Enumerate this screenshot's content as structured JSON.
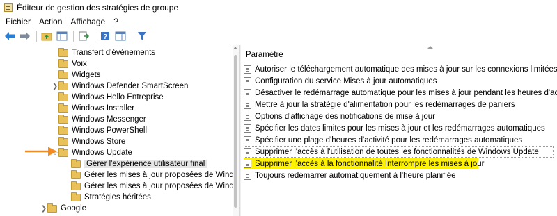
{
  "window": {
    "title": "Éditeur de gestion des stratégies de groupe",
    "icon": "gpedit-app-icon"
  },
  "menu": [
    "Fichier",
    "Action",
    "Affichage",
    "?"
  ],
  "toolbar": {
    "buttons": [
      "back-arrow-icon",
      "forward-arrow-icon",
      "up-folder-icon",
      "show-hide-tree-icon",
      "export-list-icon",
      "help-icon",
      "show-hide-action-icon",
      "filter-icon"
    ],
    "accent_back": "#2b7cd3",
    "filter_color": "#3a73c4"
  },
  "tree": {
    "items": [
      {
        "label": "Transfert d'événements",
        "expander": ""
      },
      {
        "label": "Voix",
        "expander": ""
      },
      {
        "label": "Widgets",
        "expander": ""
      },
      {
        "label": "Windows Defender SmartScreen",
        "expander": "collapsed"
      },
      {
        "label": "Windows Hello Entreprise",
        "expander": ""
      },
      {
        "label": "Windows Installer",
        "expander": ""
      },
      {
        "label": "Windows Messenger",
        "expander": ""
      },
      {
        "label": "Windows PowerShell",
        "expander": ""
      },
      {
        "label": "Windows Store",
        "expander": ""
      },
      {
        "label": "Windows Update",
        "expander": "expanded"
      },
      {
        "label": "Gérer l'expérience utilisateur final",
        "expander": ""
      },
      {
        "label": "Gérer les mises à jour proposées de Windov",
        "expander": ""
      },
      {
        "label": "Gérer les mises à jour proposées de Windov",
        "expander": ""
      },
      {
        "label": "Stratégies héritées",
        "expander": ""
      },
      {
        "label": "Google",
        "expander": "collapsed"
      }
    ],
    "selected_index": 10,
    "annotation_color": "#f08a24"
  },
  "list": {
    "header": "Paramètre",
    "items": [
      "Autoriser le téléchargement automatique des mises à jour sur les connexions limitées",
      "Configuration du service Mises à jour automatiques",
      "Désactiver le redémarrage automatique pour les mises à jour pendant les heures d'activité",
      "Mettre à jour la stratégie d'alimentation pour les redémarrages de paniers",
      "Options d'affichage des notifications de mise à jour",
      "Spécifier les dates limites pour les mises à jour et les redémarrages automatiques",
      "Spécifier une plage d'heures d'activité pour les redémarrages automatiques",
      "Supprimer l'accès à l'utilisation de toutes les fonctionnalités de Windows Update",
      "Supprimer l'accès à la fonctionnalité Interrompre les mises à jour",
      "Toujours redémarrer automatiquement à l'heure planifiée"
    ],
    "highlighted_index": 8,
    "highlight_color": "#fff200"
  }
}
